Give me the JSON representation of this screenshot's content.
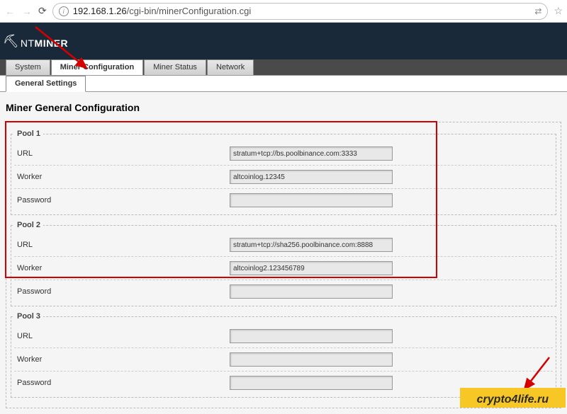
{
  "browser": {
    "url_host": "192.168.1.26",
    "url_path": "/cgi-bin/minerConfiguration.cgi"
  },
  "logo": {
    "prefix": "NT",
    "bold": "MINER"
  },
  "tabs": {
    "system": "System",
    "miner_config": "Miner Configuration",
    "miner_status": "Miner Status",
    "network": "Network"
  },
  "subtabs": {
    "general": "General Settings"
  },
  "page_title": "Miner General Configuration",
  "labels": {
    "url": "URL",
    "worker": "Worker",
    "password": "Password"
  },
  "pools": [
    {
      "legend": "Pool 1",
      "url": "stratum+tcp://bs.poolbinance.com:3333",
      "worker": "altcoinlog.12345",
      "password": ""
    },
    {
      "legend": "Pool 2",
      "url": "stratum+tcp://sha256.poolbinance.com:8888",
      "worker": "altcoinlog2.123456789",
      "password": ""
    },
    {
      "legend": "Pool 3",
      "url": "",
      "worker": "",
      "password": ""
    }
  ],
  "watermark": "crypto4life.ru"
}
